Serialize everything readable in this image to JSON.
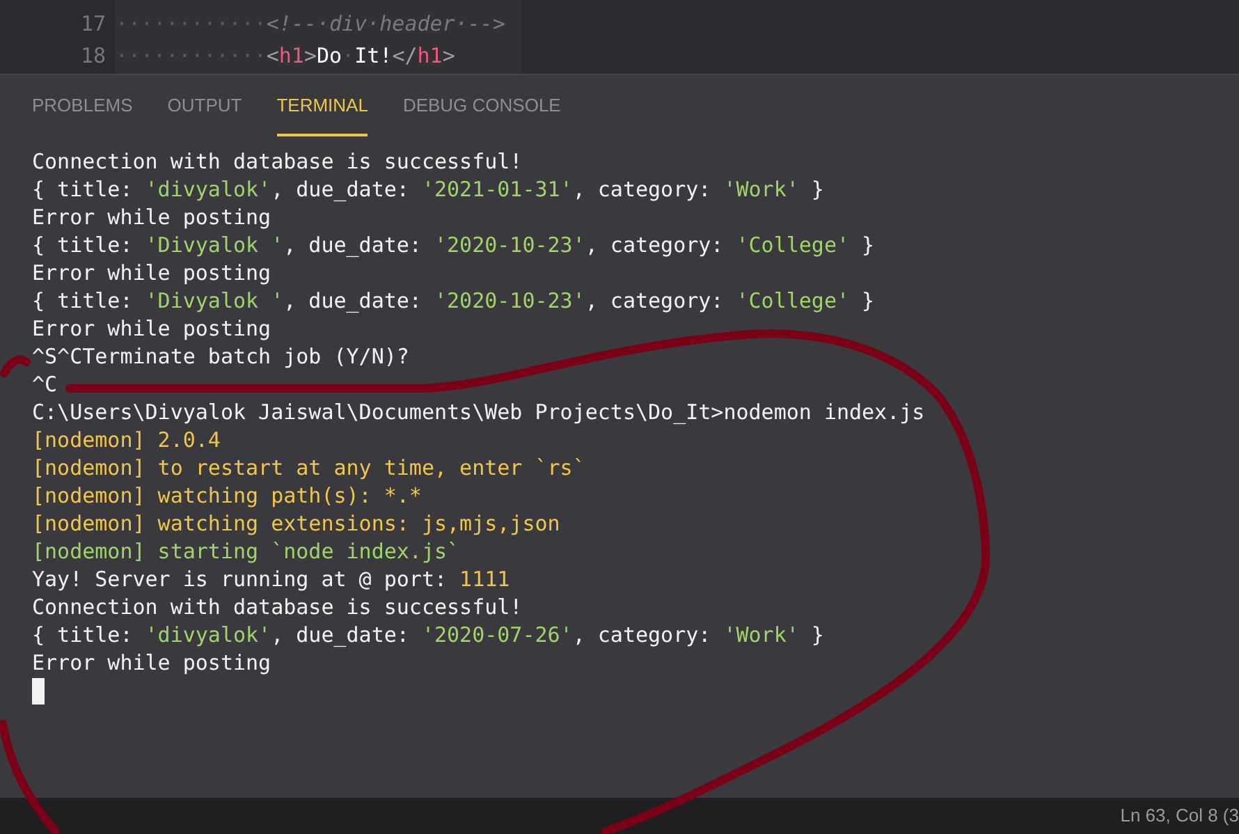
{
  "editor": {
    "lines": [
      {
        "number": "17",
        "segments": [
          {
            "kind": "ws",
            "text": "············"
          },
          {
            "kind": "comment",
            "text": "<!--·div·header·-->"
          }
        ]
      },
      {
        "number": "18",
        "segments": [
          {
            "kind": "ws",
            "text": "············"
          },
          {
            "kind": "punct",
            "text": "<"
          },
          {
            "kind": "tag",
            "text": "h1"
          },
          {
            "kind": "punct",
            "text": ">"
          },
          {
            "kind": "text",
            "text": "Do"
          },
          {
            "kind": "ws",
            "text": "·"
          },
          {
            "kind": "text",
            "text": "It!"
          },
          {
            "kind": "punct",
            "text": "</"
          },
          {
            "kind": "tag",
            "text": "h1"
          },
          {
            "kind": "punct",
            "text": ">"
          }
        ]
      }
    ]
  },
  "panel_tabs": [
    {
      "label": "PROBLEMS",
      "selected": false
    },
    {
      "label": "OUTPUT",
      "selected": false
    },
    {
      "label": "TERMINAL",
      "selected": true
    },
    {
      "label": "DEBUG CONSOLE",
      "selected": false
    }
  ],
  "terminal": {
    "lines": [
      [
        {
          "kind": "plain",
          "text": "Connection with database is successful!"
        }
      ],
      [
        {
          "kind": "plain",
          "text": "{ title: "
        },
        {
          "kind": "string",
          "text": "'divyalok'"
        },
        {
          "kind": "plain",
          "text": ", due_date: "
        },
        {
          "kind": "string",
          "text": "'2021-01-31'"
        },
        {
          "kind": "plain",
          "text": ", category: "
        },
        {
          "kind": "string",
          "text": "'Work'"
        },
        {
          "kind": "plain",
          "text": " }"
        }
      ],
      [
        {
          "kind": "plain",
          "text": "Error while posting"
        }
      ],
      [
        {
          "kind": "plain",
          "text": "{ title: "
        },
        {
          "kind": "string",
          "text": "'Divyalok '"
        },
        {
          "kind": "plain",
          "text": ", due_date: "
        },
        {
          "kind": "string",
          "text": "'2020-10-23'"
        },
        {
          "kind": "plain",
          "text": ", category: "
        },
        {
          "kind": "string",
          "text": "'College'"
        },
        {
          "kind": "plain",
          "text": " }"
        }
      ],
      [
        {
          "kind": "plain",
          "text": "Error while posting"
        }
      ],
      [
        {
          "kind": "plain",
          "text": "{ title: "
        },
        {
          "kind": "string",
          "text": "'Divyalok '"
        },
        {
          "kind": "plain",
          "text": ", due_date: "
        },
        {
          "kind": "string",
          "text": "'2020-10-23'"
        },
        {
          "kind": "plain",
          "text": ", category: "
        },
        {
          "kind": "string",
          "text": "'College'"
        },
        {
          "kind": "plain",
          "text": " }"
        }
      ],
      [
        {
          "kind": "plain",
          "text": "Error while posting"
        }
      ],
      [
        {
          "kind": "plain",
          "text": "^S^CTerminate batch job (Y/N)?"
        }
      ],
      [
        {
          "kind": "plain",
          "text": "^C"
        }
      ],
      [
        {
          "kind": "plain",
          "text": "C:\\Users\\Divyalok Jaiswal\\Documents\\Web Projects\\Do_It>nodemon index.js"
        }
      ],
      [
        {
          "kind": "yellow",
          "text": "[nodemon] 2.0.4"
        }
      ],
      [
        {
          "kind": "yellow",
          "text": "[nodemon] to restart at any time, enter `rs`"
        }
      ],
      [
        {
          "kind": "yellow",
          "text": "[nodemon] watching path(s): *.*"
        }
      ],
      [
        {
          "kind": "yellow",
          "text": "[nodemon] watching extensions: js,mjs,json"
        }
      ],
      [
        {
          "kind": "string",
          "text": "[nodemon] starting `node index.js`"
        }
      ],
      [
        {
          "kind": "plain",
          "text": "Yay! Server is running at @ port: "
        },
        {
          "kind": "yellow",
          "text": "1111"
        }
      ],
      [
        {
          "kind": "plain",
          "text": "Connection with database is successful!"
        }
      ],
      [
        {
          "kind": "plain",
          "text": "{ title: "
        },
        {
          "kind": "string",
          "text": "'divyalok'"
        },
        {
          "kind": "plain",
          "text": ", due_date: "
        },
        {
          "kind": "string",
          "text": "'2020-07-26'"
        },
        {
          "kind": "plain",
          "text": ", category: "
        },
        {
          "kind": "string",
          "text": "'Work'"
        },
        {
          "kind": "plain",
          "text": " }"
        }
      ],
      [
        {
          "kind": "plain",
          "text": "Error while posting"
        }
      ]
    ]
  },
  "status_bar": {
    "position": "Ln 63, Col 8 (3"
  }
}
